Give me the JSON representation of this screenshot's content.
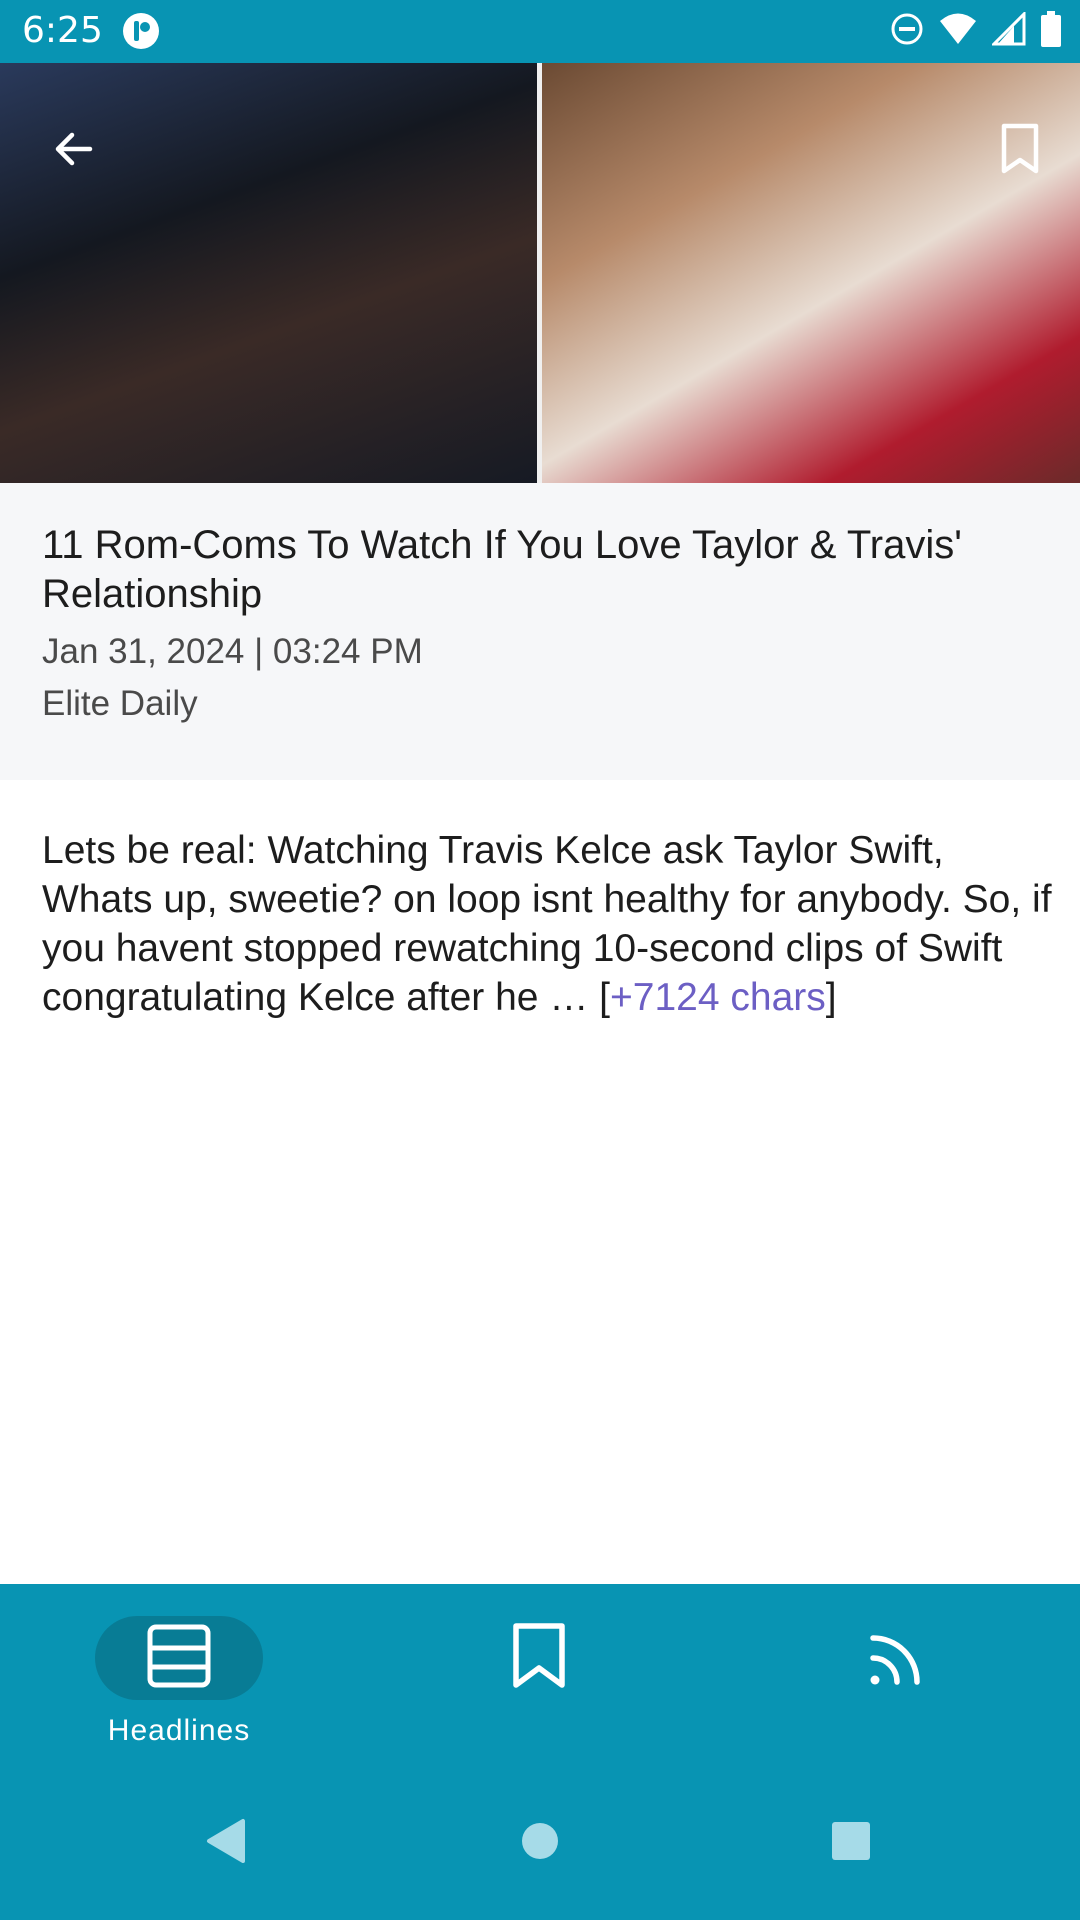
{
  "status_bar": {
    "time": "6:25",
    "icons": [
      "app-notification-icon",
      "do-not-disturb-icon",
      "wifi-icon",
      "signal-icon",
      "battery-icon"
    ]
  },
  "hero": {
    "icons": {
      "back": "arrow-left-icon",
      "bookmark": "bookmark-outline-icon"
    }
  },
  "article": {
    "title": "11 Rom-Coms To Watch If You Love Taylor & Travis' Relationship",
    "date": "Jan 31, 2024 | 03:24 PM",
    "source": "Elite Daily",
    "body": "Lets be real: Watching Travis Kelce ask Taylor Swift, Whats up, sweetie? on loop isnt healthy for anybody. So, if you havent stopped rewatching 10-second clips of Swift congratulating Kelce after he … ",
    "more_prefix": "[",
    "more_link": "+7124 chars",
    "more_suffix": "]"
  },
  "bottom_nav": {
    "items": [
      {
        "label": "Headlines",
        "icon": "headlines-icon",
        "selected": true
      },
      {
        "label": "",
        "icon": "bookmark-icon",
        "selected": false
      },
      {
        "label": "",
        "icon": "rss-feed-icon",
        "selected": false
      }
    ]
  },
  "colors": {
    "primary": "#0894b3",
    "selected_pill": "#087c95",
    "link": "#6c5fc4",
    "header_bg": "#f6f7f9"
  }
}
